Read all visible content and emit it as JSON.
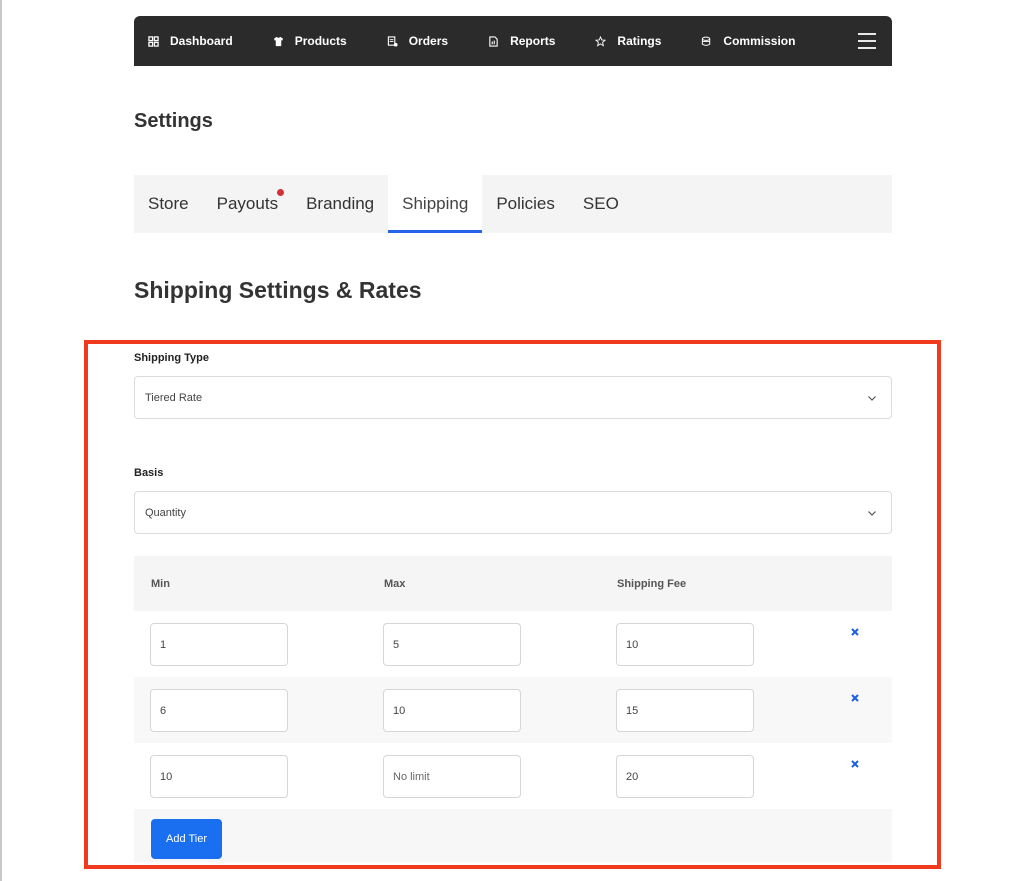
{
  "nav": {
    "items": [
      {
        "label": "Dashboard",
        "icon": "grid-icon"
      },
      {
        "label": "Products",
        "icon": "shirt-icon"
      },
      {
        "label": "Orders",
        "icon": "orders-icon"
      },
      {
        "label": "Reports",
        "icon": "report-icon"
      },
      {
        "label": "Ratings",
        "icon": "star-icon"
      },
      {
        "label": "Commission",
        "icon": "commission-icon"
      }
    ]
  },
  "page_title": "Settings",
  "tabs": [
    {
      "label": "Store",
      "active": false
    },
    {
      "label": "Payouts",
      "active": false,
      "badge": true
    },
    {
      "label": "Branding",
      "active": false
    },
    {
      "label": "Shipping",
      "active": true
    },
    {
      "label": "Policies",
      "active": false
    },
    {
      "label": "SEO",
      "active": false
    }
  ],
  "section_title": "Shipping Settings & Rates",
  "shipping_type": {
    "label": "Shipping Type",
    "value": "Tiered Rate"
  },
  "basis": {
    "label": "Basis",
    "value": "Quantity"
  },
  "tiers": {
    "headers": {
      "min": "Min",
      "max": "Max",
      "fee": "Shipping Fee"
    },
    "rows": [
      {
        "min": "1",
        "max": "5",
        "fee": "10"
      },
      {
        "min": "6",
        "max": "10",
        "fee": "15"
      },
      {
        "min": "10",
        "max": "No limit",
        "fee": "20"
      }
    ],
    "add_label": "Add Tier"
  },
  "colors": {
    "nav_bg": "#2b2b2b",
    "accent": "#2563eb",
    "button": "#1a6ff0",
    "highlight": "#f03a1e",
    "badge": "#d4303a"
  }
}
